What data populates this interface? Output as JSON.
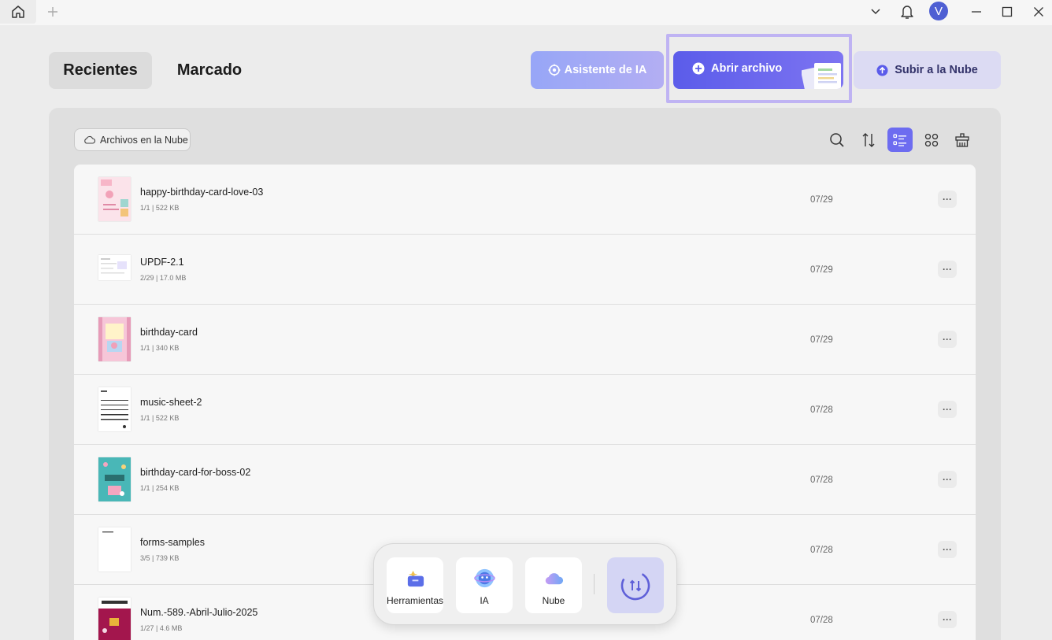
{
  "titlebar": {
    "home_icon": "home-icon",
    "new_tab_icon": "plus-icon",
    "avatar_letter": "V"
  },
  "header": {
    "tabs": [
      {
        "label": "Recientes",
        "active": true
      },
      {
        "label": "Marcado",
        "active": false
      }
    ],
    "ai_button": "Asistente de IA",
    "open_button": "Abrir archivo",
    "cloud_button": "Subir a la Nube"
  },
  "toolbar": {
    "cloud_files_label": "Archivos en la Nube",
    "view_mode": "list"
  },
  "files": [
    {
      "name": "happy-birthday-card-love-03",
      "meta": "1/1 | 522 KB",
      "date": "07/29"
    },
    {
      "name": "UPDF-2.1",
      "meta": "2/29 | 17.0 MB",
      "date": "07/29"
    },
    {
      "name": "birthday-card",
      "meta": "1/1 | 340 KB",
      "date": "07/29"
    },
    {
      "name": "music-sheet-2",
      "meta": "1/1 | 522 KB",
      "date": "07/28"
    },
    {
      "name": "birthday-card-for-boss-02",
      "meta": "1/1 | 254 KB",
      "date": "07/28"
    },
    {
      "name": "forms-samples",
      "meta": "3/5 | 739 KB",
      "date": "07/28"
    },
    {
      "name": "Num.-589.-Abril-Julio-2025",
      "meta": "1/27 | 4.6 MB",
      "date": "07/28"
    }
  ],
  "row_menu_label": "···",
  "dock": {
    "items": [
      {
        "label": "Herramientas"
      },
      {
        "label": "IA"
      },
      {
        "label": "Nube"
      }
    ]
  },
  "colors": {
    "accent": "#6d6cf0",
    "open_button": "#5b5cea",
    "ai_button": "#97a6f7",
    "cloud_button": "#dcdbf3",
    "highlight_border": "#bfb3f3"
  }
}
